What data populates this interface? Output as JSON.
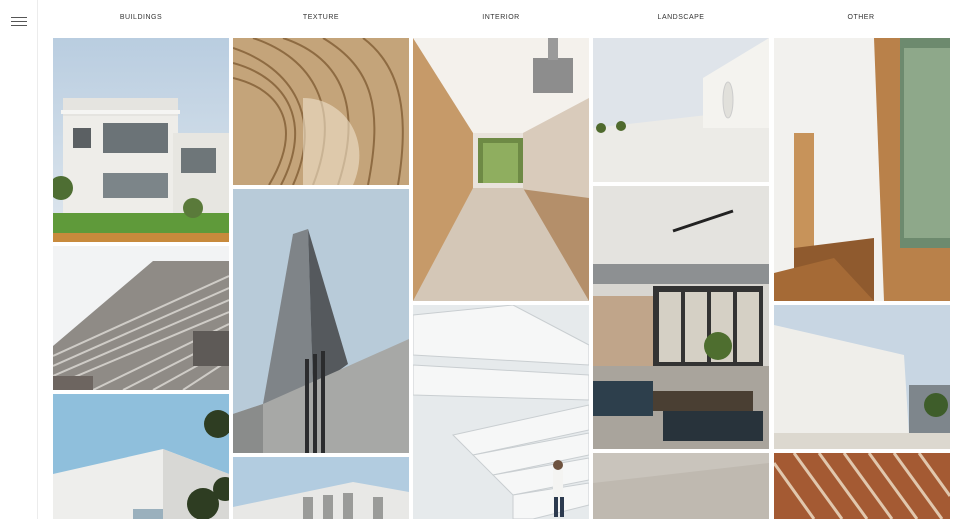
{
  "menu": {
    "icon": "hamburger-menu-icon"
  },
  "nav": {
    "items": [
      {
        "label": "BUILDINGS"
      },
      {
        "label": "TEXTURE"
      },
      {
        "label": "INTERIOR"
      },
      {
        "label": "LANDSCAPE"
      },
      {
        "label": "OTHER"
      }
    ]
  },
  "gallery": {
    "photos": [
      {
        "subject": "white-villas-photo"
      },
      {
        "subject": "wood-slat-curve-photo"
      },
      {
        "subject": "wood-kitchen-photo"
      },
      {
        "subject": "white-wall-landscape-photo"
      },
      {
        "subject": "wood-window-interior-photo"
      },
      {
        "subject": "striped-facade-photo"
      },
      {
        "subject": "concrete-wedge-building-photo"
      },
      {
        "subject": "white-staircase-photo"
      },
      {
        "subject": "open-living-room-photo"
      },
      {
        "subject": "white-warehouse-photo"
      },
      {
        "subject": "white-building-tree-photo"
      },
      {
        "subject": "grey-facade-photo"
      },
      {
        "subject": "concrete-floor-photo"
      },
      {
        "subject": "wood-diagonal-slats-photo"
      }
    ]
  }
}
